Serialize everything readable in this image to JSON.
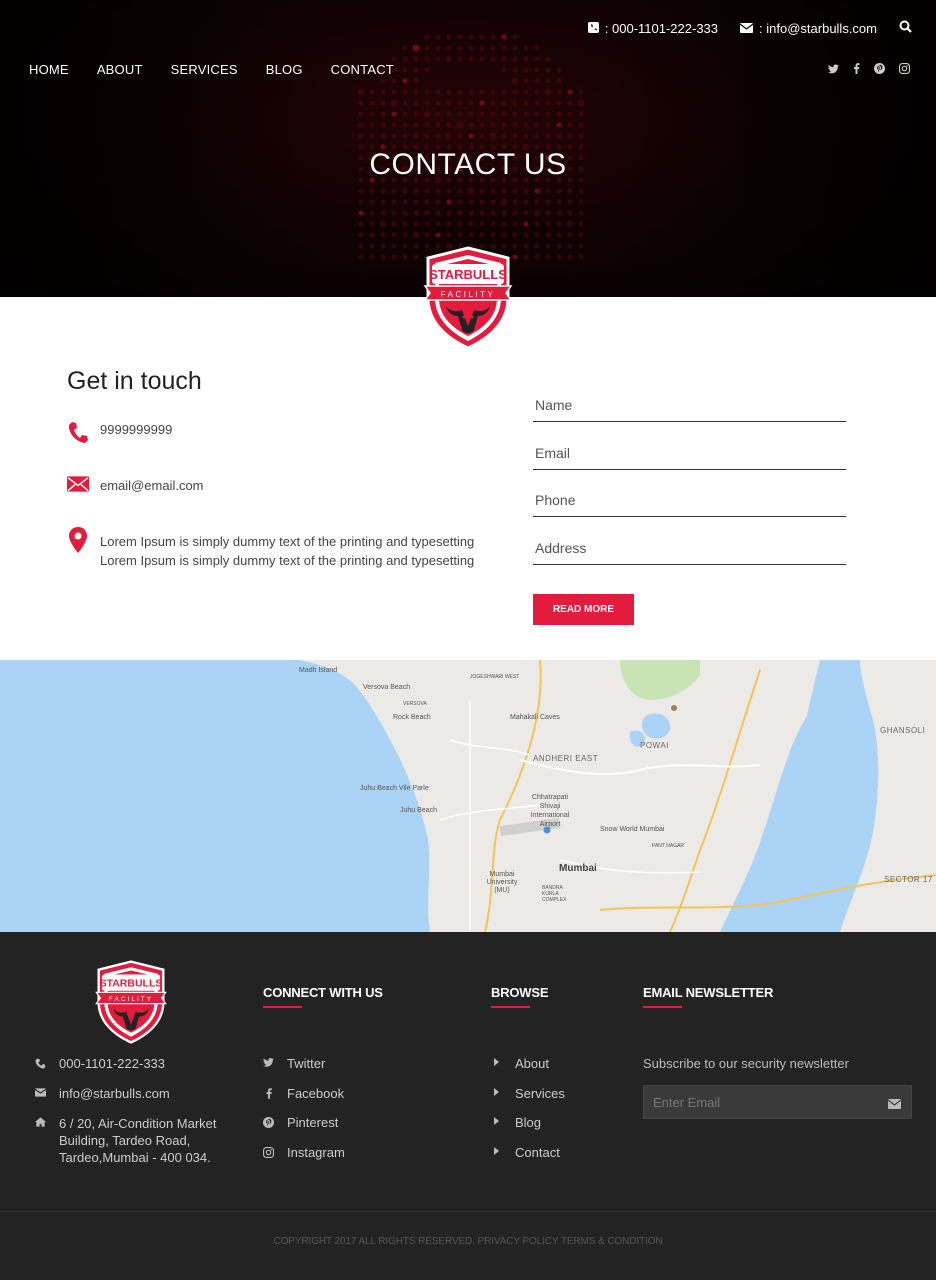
{
  "header": {
    "phone": ": 000-1101-222-333",
    "email": ": info@starbulls.com",
    "nav": [
      "HOME",
      "ABOUT",
      "SERVICES",
      "BLOG",
      "CONTACT"
    ],
    "hero_title": "CONTACT US",
    "social_icons": [
      "twitter-icon",
      "facebook-icon",
      "pinterest-icon",
      "instagram-icon"
    ]
  },
  "logo": {
    "line1": "STARBULLS",
    "line2": "FACILITY",
    "colors": {
      "primary": "#e31c3d",
      "white": "#ffffff"
    }
  },
  "contact": {
    "heading": "Get in touch",
    "phone": "9999999999",
    "email": "email@email.com",
    "address_line1": "Lorem Ipsum is simply dummy text of the printing and typesetting",
    "address_line2": "Lorem Ipsum is simply dummy text of the printing and typesetting"
  },
  "form": {
    "name_placeholder": "Name",
    "email_placeholder": "Email",
    "phone_placeholder": "Phone",
    "address_placeholder": "Address",
    "button_label": "READ MORE"
  },
  "map": {
    "labels": {
      "madh": "Madh Island",
      "versova_beach": "Versova Beach",
      "versova": "VERSOVA",
      "jogeshwari": "JOGESHWARI WEST",
      "rock_beach": "Rock Beach",
      "mahakali": "Mahakali Caves",
      "powai": "POWAI",
      "ghansoli": "GHANSOLI",
      "andheri": "ANDHERI EAST",
      "juhu_vile": "Juhu Beach Vile Parle",
      "airport": "Chhatrapati Shivaji International Airport",
      "juhu_beach": "Juhu Beach",
      "snow_world": "Snow World Mumbai",
      "mumbai": "Mumbai",
      "mumbai_uni": "Mumbai University (MU)",
      "sector17": "SECTOR 17",
      "bandra_kurla": "BANDRA KURLA COMPLEX",
      "pant_nagar": "PANT NAGAR"
    }
  },
  "footer": {
    "phone": "000-1101-222-333",
    "email": "info@starbulls.com",
    "address": "6 / 20, Air-Condition Market Building, Tardeo Road, Tardeo,Mumbai - 400 034.",
    "connect_heading": "CONNECT WITH US",
    "connect": [
      "Twitter",
      "Facebook",
      "Pinterest",
      "Instagram"
    ],
    "browse_heading": "BROWSE",
    "browse": [
      "About",
      "Services",
      "Blog",
      "Contact"
    ],
    "newsletter_heading": "EMAIL NEWSLETTER",
    "newsletter_text": "Subscribe to our security newsletter",
    "newsletter_placeholder": "Enter Email",
    "copyright": "COPYRIGHT 2017 ALL RIGHTS RESERVED. PRIVACY POLICY TERMS & CONDITION"
  }
}
